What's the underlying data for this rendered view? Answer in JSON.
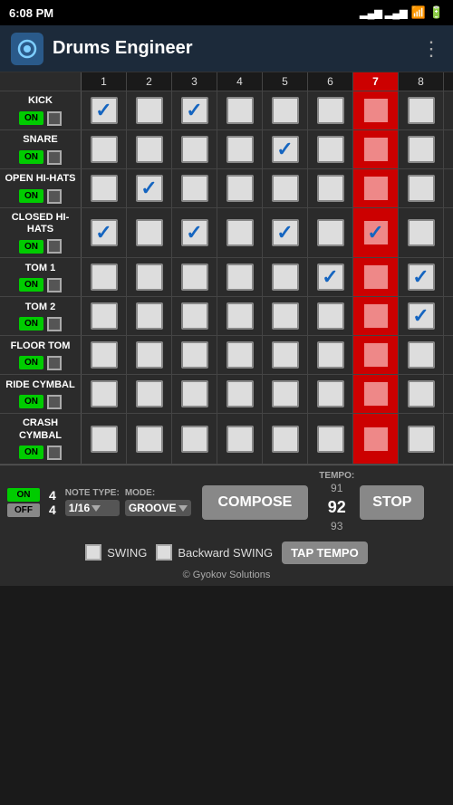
{
  "statusBar": {
    "time": "6:08 PM",
    "battery": "🔋"
  },
  "header": {
    "title": "Drums Engineer",
    "menuIcon": "⋮"
  },
  "columns": {
    "numbers": [
      "1",
      "2",
      "3",
      "4",
      "5",
      "6",
      "7",
      "8"
    ],
    "highlightedCol": 6
  },
  "drums": [
    {
      "name": "KICK",
      "beats": [
        true,
        false,
        true,
        false,
        false,
        false,
        false,
        false
      ],
      "on": true
    },
    {
      "name": "SNARE",
      "beats": [
        false,
        false,
        false,
        false,
        true,
        false,
        false,
        false
      ],
      "on": true
    },
    {
      "name": "OPEN HI-HATS",
      "beats": [
        false,
        true,
        false,
        false,
        false,
        false,
        false,
        false
      ],
      "on": true
    },
    {
      "name": "CLOSED HI-HATS",
      "beats": [
        true,
        false,
        true,
        false,
        true,
        false,
        true,
        false
      ],
      "on": true
    },
    {
      "name": "TOM 1",
      "beats": [
        false,
        false,
        false,
        false,
        false,
        true,
        false,
        true
      ],
      "on": true
    },
    {
      "name": "TOM 2",
      "beats": [
        false,
        false,
        false,
        false,
        false,
        false,
        false,
        true
      ],
      "on": true
    },
    {
      "name": "FLOOR TOM",
      "beats": [
        false,
        false,
        false,
        false,
        false,
        false,
        false,
        false
      ],
      "on": true
    },
    {
      "name": "RIDE CYMBAL",
      "beats": [
        false,
        false,
        false,
        false,
        false,
        false,
        false,
        false
      ],
      "on": true
    },
    {
      "name": "CRASH CYMBAL",
      "beats": [
        false,
        false,
        false,
        false,
        false,
        false,
        false,
        false
      ],
      "on": true
    }
  ],
  "toolbar": {
    "onLabel": "ON",
    "offLabel": "OFF",
    "timeSig": "4/4",
    "noteTypeLabel": "NOTE TYPE:",
    "noteTypeValue": "1/16",
    "modeLabel": "MODE:",
    "modeValue": "GROOVE",
    "composeLabel": "COMPOSE",
    "tempoLabel": "TEMPO:",
    "tempoPrev": "91",
    "tempoCurrent": "92",
    "tempoNext": "93",
    "stopLabel": "STOP",
    "swingLabel": "SWING",
    "backwardSwingLabel": "Backward SWING",
    "tapTempoLabel": "TAP TEMPO",
    "credit": "© Gyokov Solutions"
  }
}
